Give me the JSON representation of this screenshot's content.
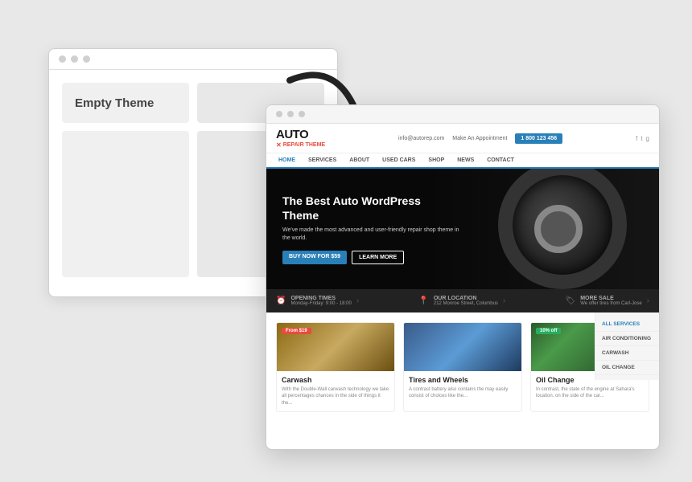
{
  "background_color": "#e8e8e8",
  "empty_browser": {
    "dots": [
      "dot1",
      "dot2",
      "dot3"
    ],
    "header_text": "Empty Theme",
    "aria_label": "Empty theme browser mockup"
  },
  "arrow": {
    "direction": "down-right",
    "aria_label": "Arrow pointing to themed result"
  },
  "theme_browser": {
    "dots": [
      "dot1",
      "dot2",
      "dot3"
    ],
    "topbar": {
      "logo": "AUTO",
      "logo_sub": "REPAIR THEME",
      "contact_email": "info@autorep.com",
      "contact_book": "Make An Appointment",
      "phone": "1 800 123 456"
    },
    "nav": {
      "items": [
        "HOME",
        "SERVICES",
        "ABOUT",
        "USED CARS",
        "SHOP",
        "NEWS",
        "CONTACT"
      ],
      "active": "HOME"
    },
    "hero": {
      "title": "The Best Auto WordPress Theme",
      "subtitle": "We've made the most advanced and user-friendly repair shop theme in the world.",
      "btn_primary": "BUY NOW FOR $59",
      "btn_secondary": "LEARN MORE"
    },
    "infobar": {
      "item1_label": "OPENING TIMES",
      "item1_value": "Monday-Friday: 9:00 - 18:00",
      "item2_label": "OUR LOCATION",
      "item2_value": "212 Monroe Street, Columbus",
      "item3_label": "MORE SALE",
      "item3_value": "We offer tires from Carl-Jose"
    },
    "cards": [
      {
        "title": "Carwash",
        "badge": "From $19",
        "badge_color": "red",
        "text": "With the Double-Wall carwash technology we take all percentages chances in the side of things it the..."
      },
      {
        "title": "Tires and Wheels",
        "badge": null,
        "text": "A contrast battery also contains the may easily consist of choices like the..."
      },
      {
        "title": "Oil Change",
        "badge": "10% off",
        "badge_color": "green",
        "text": "In contrast, the state of the engine at Sahara's location, on the side of the car..."
      }
    ],
    "sidebar_services": [
      "ALL SERVICES",
      "AIR CONDITIONING",
      "CARWASH",
      "OIL CHANGE"
    ]
  }
}
